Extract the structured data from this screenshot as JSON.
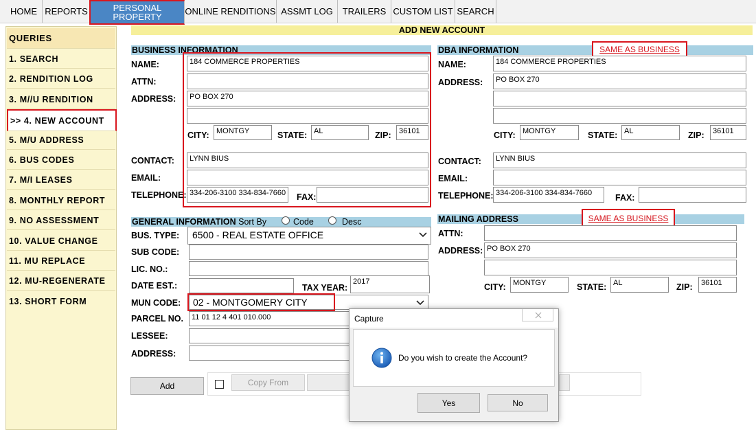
{
  "nav": {
    "tabs": [
      "HOME",
      "REPORTS",
      "PERSONAL PROPERTY",
      "ONLINE RENDITIONS",
      "ASSMT LOG",
      "TRAILERS",
      "CUSTOM LIST",
      "SEARCH"
    ]
  },
  "sidebar": {
    "title": "QUERIES",
    "items": [
      "1. SEARCH",
      "2. RENDITION LOG",
      "3. M//U RENDITION",
      ">> 4. NEW ACCOUNT",
      "5. M/U ADDRESS",
      "6. BUS CODES",
      "7. M/I LEASES",
      "8. MONTHLY REPORT",
      "9. NO ASSESSMENT",
      "10. VALUE CHANGE",
      "11. MU REPLACE",
      "12. MU-REGENERATE",
      "13. SHORT FORM"
    ]
  },
  "page": {
    "title": "ADD NEW ACCOUNT"
  },
  "business": {
    "header": "BUSINESS INFORMATION",
    "labels": {
      "name": "NAME:",
      "attn": "ATTN:",
      "address": "ADDRESS:",
      "city": "CITY:",
      "state": "STATE:",
      "zip": "ZIP:",
      "contact": "CONTACT:",
      "email": "EMAIL:",
      "telephone": "TELEPHONE:",
      "fax": "FAX:"
    },
    "values": {
      "name": "184 COMMERCE PROPERTIES",
      "attn": "",
      "address1": "PO BOX 270",
      "address2": "",
      "city": "MONTGY",
      "state": "AL",
      "zip": "36101",
      "contact": "LYNN BIUS",
      "email": "",
      "telephone": "334-206-3100  334-834-7660",
      "fax": ""
    }
  },
  "dba": {
    "header": "DBA INFORMATION",
    "same_link": "SAME AS BUSINESS",
    "labels": {
      "name": "NAME:",
      "address": "ADDRESS:",
      "city": "CITY:",
      "state": "STATE:",
      "zip": "ZIP:",
      "contact": "CONTACT:",
      "email": "EMAIL:",
      "telephone": "TELEPHONE:",
      "fax": "FAX:"
    },
    "values": {
      "name": "184 COMMERCE PROPERTIES",
      "address1": "PO BOX 270",
      "address2": "",
      "address3": "",
      "city": "MONTGY",
      "state": "AL",
      "zip": "36101",
      "contact": "LYNN BIUS",
      "email": "",
      "telephone": "334-206-3100  334-834-7660",
      "fax": ""
    }
  },
  "general": {
    "header": "GENERAL INFORMATION",
    "sort_by": "Sort By",
    "sort_code": "Code",
    "sort_desc": "Desc",
    "labels": {
      "bus_type": "BUS. TYPE:",
      "sub_code": "SUB CODE:",
      "lic_no": "LIC. NO.:",
      "date_est": "DATE EST.:",
      "tax_year": "TAX YEAR:",
      "mun_code": "MUN CODE:",
      "parcel_no": "PARCEL NO.",
      "lessee": "LESSEE:",
      "address": "ADDRESS:"
    },
    "values": {
      "bus_type": "6500 - REAL ESTATE OFFICE",
      "sub_code": "",
      "lic_no": "",
      "date_est": "",
      "tax_year": "2017",
      "mun_code": "02 - MONTGOMERY CITY",
      "parcel_no": "11 01 12 4 401 010.000",
      "lessee": "",
      "address": ""
    }
  },
  "mailing": {
    "header": "MAILING ADDRESS",
    "same_link": "SAME AS BUSINESS",
    "labels": {
      "attn": "ATTN:",
      "address": "ADDRESS:",
      "city": "CITY:",
      "state": "STATE:",
      "zip": "ZIP:"
    },
    "values": {
      "attn": "",
      "address1": "PO BOX 270",
      "address2": "",
      "city": "MONTGY",
      "state": "AL",
      "zip": "36101"
    }
  },
  "actions": {
    "add": "Add",
    "copy_from": "Copy From"
  },
  "dialog": {
    "title": "Capture",
    "message": "Do you wish to create the Account?",
    "yes": "Yes",
    "no": "No"
  },
  "colors": {
    "nav_active": "#4a86c5",
    "sidebar_bg": "#fbf6cf",
    "title_bar": "#f6ef9a",
    "section_bar": "#a8d1e3",
    "highlight": "#d9161e"
  }
}
